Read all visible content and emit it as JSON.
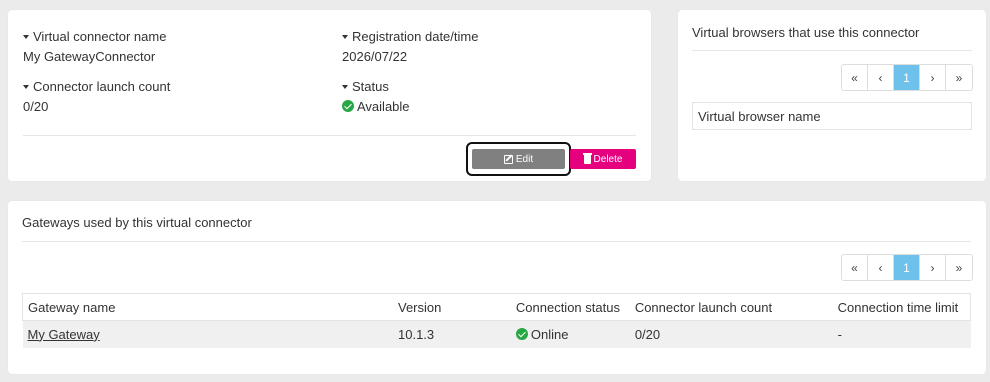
{
  "connector": {
    "name_label": "Virtual connector name",
    "name_value": "My GatewayConnector",
    "registration_label": "Registration date/time",
    "registration_value": "2026/07/22",
    "launch_count_label": "Connector launch count",
    "launch_count_value": "0/20",
    "status_label": "Status",
    "status_value": "Available",
    "edit_label": "Edit",
    "delete_label": "Delete"
  },
  "browsers_panel": {
    "title": "Virtual browsers that use this connector",
    "column_header": "Virtual browser name",
    "pager": {
      "first": "«",
      "prev": "‹",
      "current": "1",
      "next": "›",
      "last": "»"
    }
  },
  "gateways_panel": {
    "title": "Gateways used by this virtual connector",
    "pager": {
      "first": "«",
      "prev": "‹",
      "current": "1",
      "next": "›",
      "last": "»"
    },
    "columns": [
      "Gateway name",
      "Version",
      "Connection status",
      "Connector launch count",
      "Connection time limit"
    ],
    "rows": [
      {
        "name": "My Gateway",
        "version": "10.1.3",
        "status": "Online",
        "launch_count": "0/20",
        "time_limit": "-"
      }
    ]
  },
  "colors": {
    "accent_delete": "#e5007d",
    "pager_active": "#6ec1ea",
    "status_ok": "#28a745",
    "edit_button": "#808080"
  }
}
